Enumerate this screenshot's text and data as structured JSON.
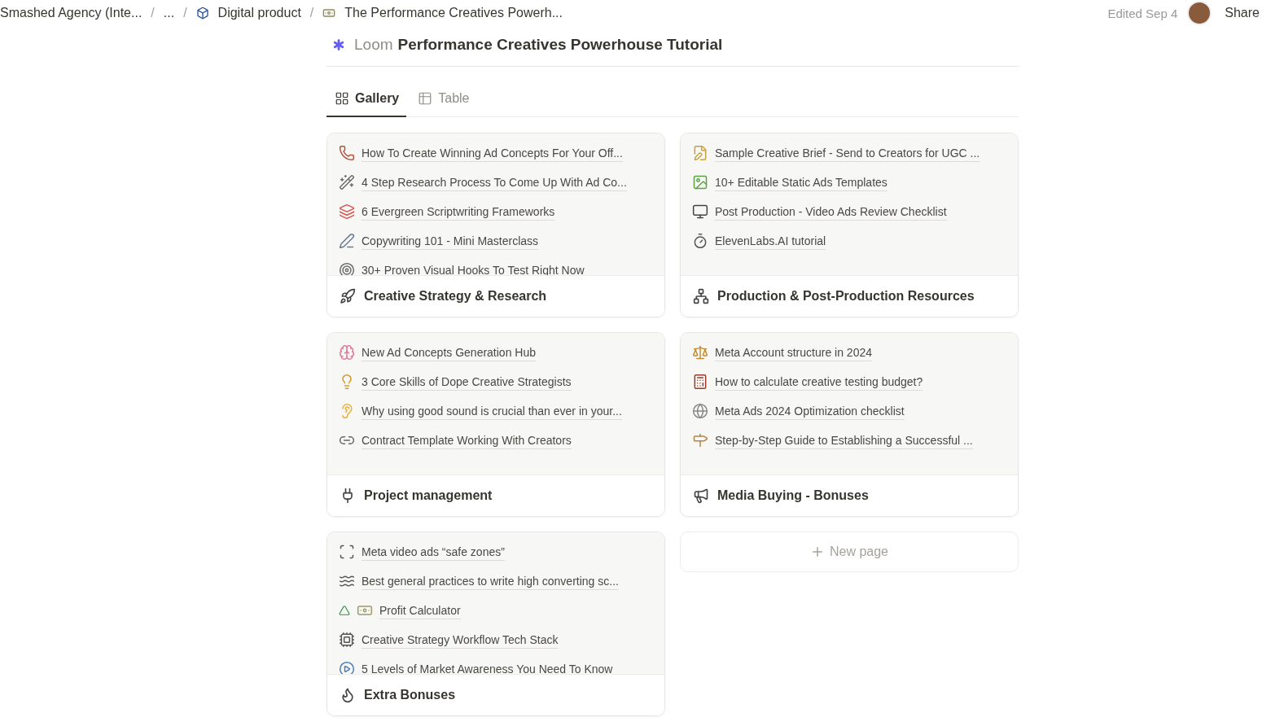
{
  "breadcrumb": [
    {
      "label": "Smashed Agency (Inte..."
    },
    {
      "label": "..."
    },
    {
      "label": "Digital product"
    },
    {
      "label": "The Performance Creatives Powerh..."
    }
  ],
  "breadcrumb_separator": "/",
  "header": {
    "edited": "Edited Sep 4",
    "share": "Share"
  },
  "page": {
    "prefix": "Loom",
    "title": "Performance Creatives Powerhouse Tutorial"
  },
  "tabs": [
    {
      "label": "Gallery",
      "selected": true
    },
    {
      "label": "Table",
      "selected": false
    }
  ],
  "cards": [
    {
      "title": "Creative Strategy & Research",
      "items": [
        "How To Create Winning Ad Concepts For Your Off...",
        "4 Step Research Process To Come Up With Ad Co...",
        "6 Evergreen Scriptwriting Frameworks",
        "Copywriting 101 - Mini Masterclass",
        "30+ Proven Visual Hooks To Test Right Now"
      ]
    },
    {
      "title": "Production & Post-Production Resources",
      "items": [
        "Sample Creative Brief - Send to Creators for UGC ...",
        "10+ Editable Static Ads Templates",
        "Post Production - Video Ads Review Checklist",
        "ElevenLabs.AI tutorial"
      ]
    },
    {
      "title": "Project management",
      "items": [
        "New Ad Concepts Generation Hub",
        "3 Core Skills of Dope Creative Strategists",
        "Why using good sound is crucial than ever in your...",
        "Contract Template Working With Creators"
      ]
    },
    {
      "title": "Media Buying - Bonuses",
      "items": [
        "Meta Account structure in 2024",
        "How to calculate creative testing budget?",
        "Meta Ads 2024 Optimization checklist",
        "Step-by-Step Guide to Establishing a Successful ..."
      ]
    },
    {
      "title": "Extra Bonuses",
      "items": [
        "Meta video ads “safe zones”",
        "Best general practices to write high converting sc...",
        "Profit Calculator",
        "Creative Strategy Workflow Tech Stack",
        "5 Levels of Market Awareness You Need To Know"
      ]
    }
  ],
  "new_page": "New page"
}
